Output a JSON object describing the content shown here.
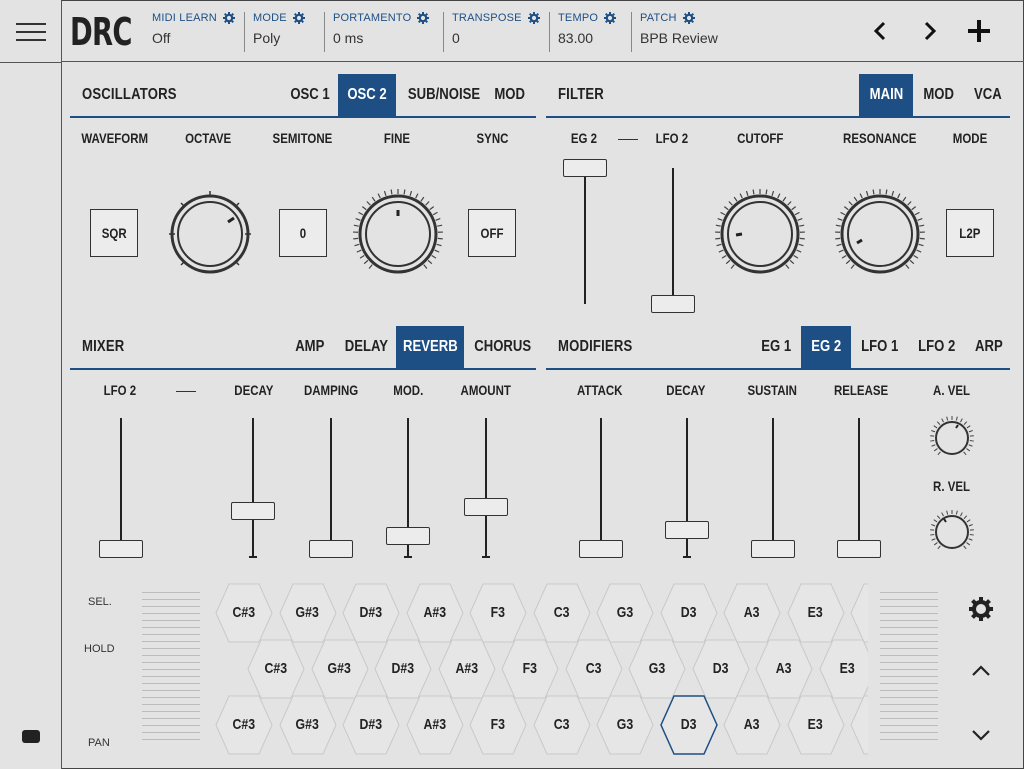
{
  "header": {
    "logo": "DRC",
    "params": [
      {
        "label": "MIDI LEARN",
        "value": "Off"
      },
      {
        "label": "MODE",
        "value": "Poly"
      },
      {
        "label": "PORTAMENTO",
        "value": "0 ms"
      },
      {
        "label": "TRANSPOSE",
        "value": "0"
      },
      {
        "label": "TEMPO",
        "value": "83.00"
      },
      {
        "label": "PATCH",
        "value": "BPB Review"
      }
    ],
    "prev_label": "‹",
    "next_label": "›",
    "add_label": "+"
  },
  "oscillators": {
    "title": "OSCILLATORS",
    "tabs": [
      "OSC 1",
      "OSC 2",
      "SUB/NOISE",
      "MOD"
    ],
    "active_tab": "OSC 2",
    "labels": [
      "WAVEFORM",
      "OCTAVE",
      "SEMITONE",
      "FINE",
      "SYNC"
    ],
    "waveform": "SQR",
    "semitone": "0",
    "sync": "OFF"
  },
  "filter": {
    "title": "FILTER",
    "tabs": [
      "MAIN",
      "MOD",
      "VCA"
    ],
    "active_tab": "MAIN",
    "labels": [
      "EG 2",
      "LFO 2",
      "CUTOFF",
      "RESONANCE",
      "MODE"
    ],
    "mode": "L2P",
    "eg2_level": 1.0,
    "lfo2_level": 0.0
  },
  "mixer": {
    "title": "MIXER",
    "tabs": [
      "AMP",
      "DELAY",
      "REVERB",
      "CHORUS"
    ],
    "active_tab": "REVERB",
    "labels": [
      "LFO 2",
      "DECAY",
      "DAMPING",
      "MOD.",
      "AMOUNT"
    ],
    "levels": [
      0.0,
      0.3,
      0.0,
      0.1,
      0.33
    ]
  },
  "modifiers": {
    "title": "MODIFIERS",
    "tabs": [
      "EG 1",
      "EG 2",
      "LFO 1",
      "LFO 2",
      "ARP"
    ],
    "active_tab": "EG 2",
    "labels": [
      "ATTACK",
      "DECAY",
      "SUSTAIN",
      "RELEASE",
      "A. VEL",
      "R. VEL"
    ],
    "levels": [
      0.0,
      0.15,
      0.0,
      0.0
    ]
  },
  "keyboard": {
    "side_labels": [
      "SEL.",
      "HOLD",
      "PAN"
    ],
    "rows": [
      [
        "C#3",
        "G#3",
        "D#3",
        "A#3",
        "F3",
        "C3",
        "G3",
        "D3",
        "A3",
        "E3"
      ],
      [
        "C#3",
        "G#3",
        "D#3",
        "A#3",
        "F3",
        "C3",
        "G3",
        "D3",
        "A3",
        "E3"
      ],
      [
        "C#3",
        "G#3",
        "D#3",
        "A#3",
        "F3",
        "C3",
        "G3",
        "D3",
        "A3",
        "E3"
      ]
    ],
    "highlighted": "D3 (row 3)"
  },
  "colors": {
    "accent": "#1d4f85",
    "background": "#e3e3e3"
  },
  "icons": [
    "menu-icon",
    "keyboard-icon",
    "gear-icon",
    "chevron-up-icon",
    "chevron-down-icon"
  ]
}
